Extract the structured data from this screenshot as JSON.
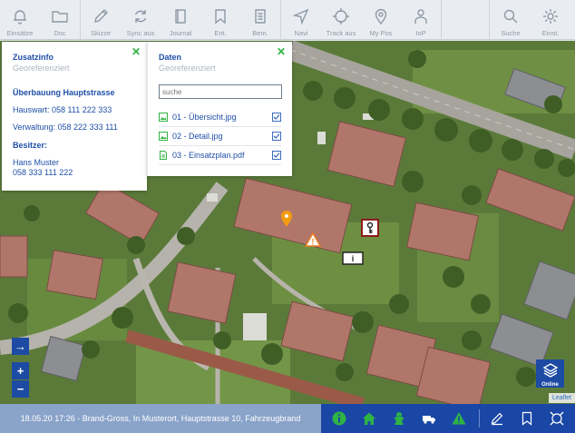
{
  "toolbar": {
    "items": [
      {
        "label": "Einsätze",
        "icon": "bell-icon"
      },
      {
        "label": "Doc",
        "icon": "folder-icon"
      },
      {
        "label": "Skizze",
        "icon": "pencil-icon"
      },
      {
        "label": "Sync aus",
        "icon": "sync-icon"
      },
      {
        "label": "Journal",
        "icon": "book-icon"
      },
      {
        "label": "Ent.",
        "icon": "bookmark-icon"
      },
      {
        "label": "Bem.",
        "icon": "document-icon"
      },
      {
        "label": "Navi",
        "icon": "navigation-icon"
      },
      {
        "label": "Track aus",
        "icon": "target-icon"
      },
      {
        "label": "My Pos",
        "icon": "location-pin-icon"
      },
      {
        "label": "IoP",
        "icon": "person-icon"
      },
      {
        "label": "Suche",
        "icon": "search-icon"
      },
      {
        "label": "Einst.",
        "icon": "gear-icon"
      }
    ]
  },
  "info_panel": {
    "title": "Zusatzinfo",
    "subtitle": "Georeferenziert",
    "object_name": "Überbauung Hauptstrasse",
    "hauswart": "Hauswart: 058 111 222 333",
    "verwaltung": "Verwaltung: 058 222 333 111",
    "owner_label": "Besitzer:",
    "owner_name": "Hans Muster",
    "owner_phone": "058 333 111 222"
  },
  "data_panel": {
    "title": "Daten",
    "subtitle": "Georeferenziert",
    "search_placeholder": "suche",
    "files": [
      {
        "name": "01 - Übersicht.jpg",
        "type": "image",
        "checked": true
      },
      {
        "name": "02 - Detail.jpg",
        "type": "image",
        "checked": true
      },
      {
        "name": "03 - Einsatzplan.pdf",
        "type": "pdf",
        "checked": true
      }
    ]
  },
  "map": {
    "controls": {
      "arrow": "→",
      "zoom_in": "+",
      "zoom_out": "−"
    },
    "online_label": "Online",
    "attribution": "Leaflet"
  },
  "status": {
    "text": "18.05.20 17:26 - Brand-Gross, In Musterort, Hauptstrasse 10, Fahrzeugbrand"
  },
  "actions": [
    {
      "icon": "info-icon",
      "color": "#2fb344"
    },
    {
      "icon": "house-icon",
      "color": "#2fb344"
    },
    {
      "icon": "hydrant-icon",
      "color": "#2fb344"
    },
    {
      "icon": "truck-icon",
      "color": "#ffffff"
    },
    {
      "icon": "warning-icon",
      "color": "#2fb344"
    },
    {
      "icon": "pencil-icon",
      "color": "#ffffff"
    },
    {
      "icon": "bookmark-icon",
      "color": "#ffffff"
    },
    {
      "icon": "expand-icon",
      "color": "#ffffff"
    }
  ],
  "colors": {
    "accent": "#1d4ba3",
    "green": "#2fb344",
    "status_bg": "#8aa3c9"
  }
}
